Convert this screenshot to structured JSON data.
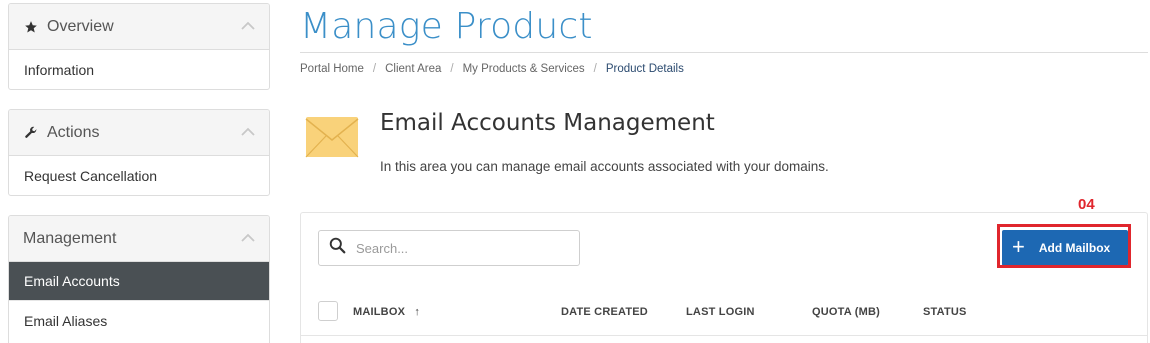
{
  "sidebar": {
    "panels": [
      {
        "title": "Overview",
        "icon": "star-icon",
        "items": [
          "Information"
        ]
      },
      {
        "title": "Actions",
        "icon": "wrench-icon",
        "items": [
          "Request Cancellation"
        ]
      },
      {
        "title": "Management",
        "icon": "",
        "items": [
          "Email Accounts",
          "Email Aliases"
        ],
        "active_item": "Email Accounts"
      }
    ]
  },
  "header": {
    "title": "Manage Product",
    "breadcrumb": [
      "Portal Home",
      "Client Area",
      "My Products & Services",
      "Product Details"
    ]
  },
  "section": {
    "title": "Email Accounts Management",
    "description": "In this area you can manage email accounts associated with your domains.",
    "icon": "envelope-icon"
  },
  "toolbar": {
    "search_placeholder": "Search...",
    "add_button_label": "Add Mailbox",
    "annotation_number": "04"
  },
  "table": {
    "columns": [
      "MAILBOX",
      "DATE CREATED",
      "LAST LOGIN",
      "QUOTA (MB)",
      "STATUS"
    ],
    "sort_indicator": "↑"
  },
  "colors": {
    "title_blue": "#3b8fc8",
    "button_blue": "#1d68b3",
    "active_nav": "#4a5054",
    "annotation_red": "#e0262d",
    "envelope_yellow": "#f9d27a"
  }
}
